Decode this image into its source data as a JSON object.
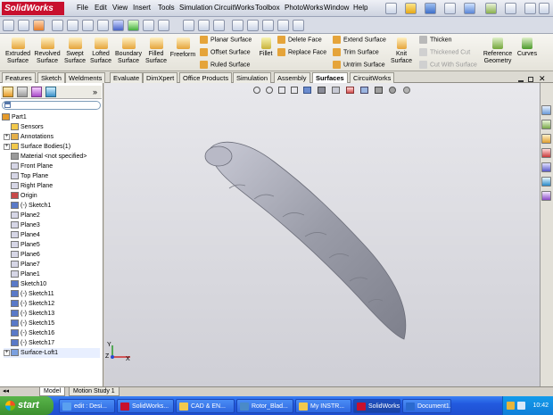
{
  "app": {
    "logo_text": "SolidWorks"
  },
  "menu": [
    "File",
    "Edit",
    "View",
    "Insert",
    "Tools",
    "Simulation",
    "CircuitWorks",
    "Toolbox",
    "PhotoWorks",
    "Window",
    "Help"
  ],
  "command_manager": {
    "big_tools": [
      {
        "label": "Extruded\nSurface"
      },
      {
        "label": "Revolved\nSurface"
      },
      {
        "label": "Swept\nSurface"
      },
      {
        "label": "Lofted\nSurface"
      },
      {
        "label": "Boundary\nSurface"
      },
      {
        "label": "Filled\nSurface"
      },
      {
        "label": "Freeform"
      }
    ],
    "col1": [
      "Planar Surface",
      "Offset Surface",
      "Ruled Surface"
    ],
    "fillet": "Fillet",
    "col2": [
      "Delete Face",
      "Replace Face"
    ],
    "col3": [
      "Extend Surface",
      "Trim Surface",
      "Untrim Surface"
    ],
    "knit": "Knit\nSurface",
    "col4": [
      "Thicken",
      "Thickened Cut",
      "Cut With Surface"
    ],
    "reference_geometry": "Reference\nGeometry",
    "curves": "Curves"
  },
  "tabs": [
    "Features",
    "Sketch",
    "Weldments",
    "Evaluate",
    "DimXpert",
    "Office Products",
    "Simulation",
    "Assembly",
    "Surfaces",
    "CircuitWorks"
  ],
  "active_tab": "Surfaces",
  "tree": [
    {
      "label": "Part1",
      "icon": "part-icon",
      "expand": false
    },
    {
      "label": "Sensors",
      "icon": "folder-icon",
      "expand": false
    },
    {
      "label": "Annotations",
      "icon": "annotation-icon",
      "expand": true
    },
    {
      "label": "Surface Bodies(1)",
      "icon": "folder-icon",
      "expand": true
    },
    {
      "label": "Material <not specified>",
      "icon": "material-icon",
      "expand": false
    },
    {
      "label": "Front Plane",
      "icon": "plane-icon",
      "expand": false
    },
    {
      "label": "Top Plane",
      "icon": "plane-icon",
      "expand": false
    },
    {
      "label": "Right Plane",
      "icon": "plane-icon",
      "expand": false
    },
    {
      "label": "Origin",
      "icon": "origin-icon",
      "expand": false
    },
    {
      "label": "(-) Sketch1",
      "icon": "sketch-icon",
      "expand": false
    },
    {
      "label": "Plane2",
      "icon": "plane-icon",
      "expand": false
    },
    {
      "label": "Plane3",
      "icon": "plane-icon",
      "expand": false
    },
    {
      "label": "Plane4",
      "icon": "plane-icon",
      "expand": false
    },
    {
      "label": "Plane5",
      "icon": "plane-icon",
      "expand": false
    },
    {
      "label": "Plane6",
      "icon": "plane-icon",
      "expand": false
    },
    {
      "label": "Plane7",
      "icon": "plane-icon",
      "expand": false
    },
    {
      "label": "Plane1",
      "icon": "plane-icon",
      "expand": false
    },
    {
      "label": "Sketch10",
      "icon": "sketch-icon",
      "expand": false
    },
    {
      "label": "(-) Sketch11",
      "icon": "sketch-icon",
      "expand": false
    },
    {
      "label": "(-) Sketch12",
      "icon": "sketch-icon",
      "expand": false
    },
    {
      "label": "(-) Sketch13",
      "icon": "sketch-icon",
      "expand": false
    },
    {
      "label": "(-) Sketch15",
      "icon": "sketch-icon",
      "expand": false
    },
    {
      "label": "(-) Sketch16",
      "icon": "sketch-icon",
      "expand": false
    },
    {
      "label": "(-) Sketch17",
      "icon": "sketch-icon",
      "expand": false
    },
    {
      "label": "Surface-Loft1",
      "icon": "loft-icon",
      "expand": true
    }
  ],
  "axes": {
    "x": "X",
    "y": "Y",
    "z": "Z"
  },
  "bottom_tabs": [
    "Model",
    "Motion Study 1"
  ],
  "taskbar": {
    "start": "start",
    "tasks": [
      "edit : Desi...",
      "SolidWorks...",
      "CAD & EN...",
      "Rotor_Blad...",
      "My INSTR...",
      "SolidWorks...",
      "Document1..."
    ],
    "clock": "10:42"
  },
  "colors": {
    "accent": "#c8102e",
    "model": "#9a9ca8",
    "taskbar": "#245edb",
    "start": "#3c8f2f"
  }
}
